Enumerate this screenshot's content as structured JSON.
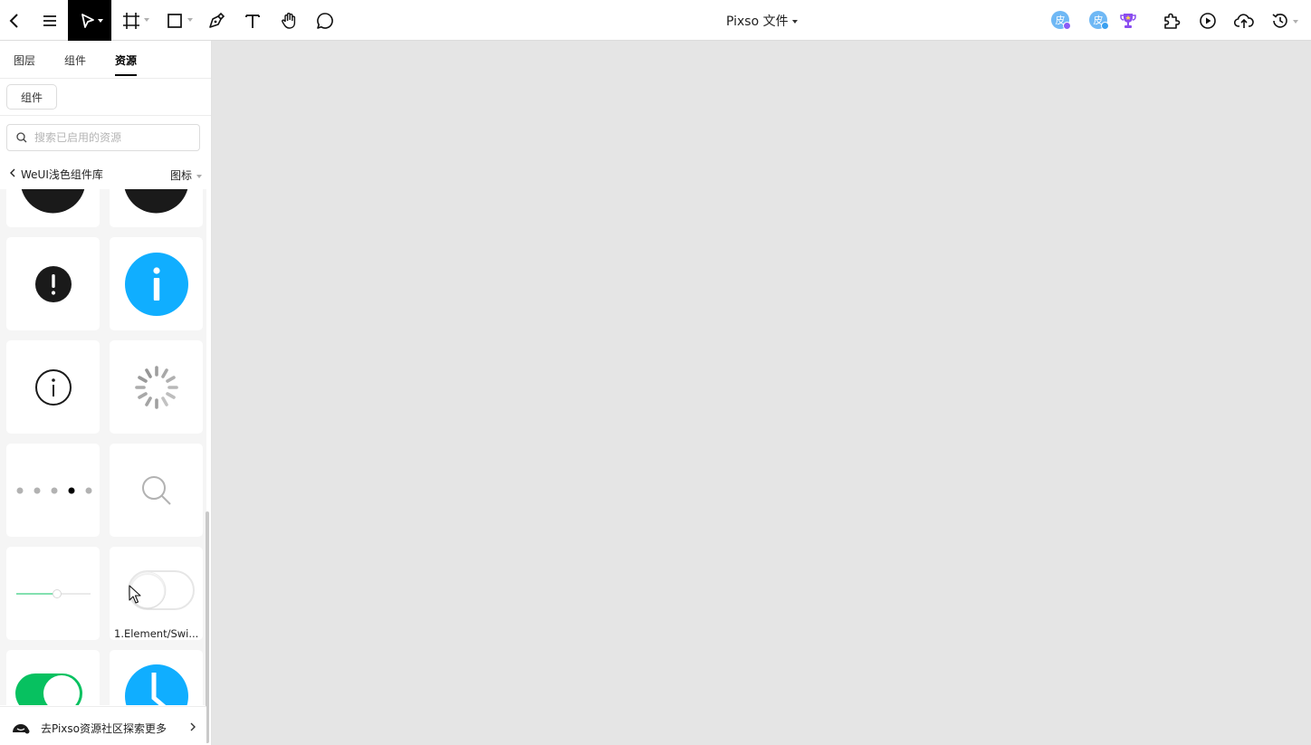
{
  "toolbar": {
    "doc_title": "Pixso 文件",
    "tools": [
      "back-icon",
      "menu-icon",
      "move-tool-icon",
      "frame-tool-icon",
      "shape-tool-icon",
      "pen-tool-icon",
      "text-tool-icon",
      "hand-tool-icon",
      "comment-tool-icon"
    ],
    "right_icons": [
      "plugin-icon",
      "play-icon",
      "upload-icon",
      "history-icon"
    ],
    "avatars": [
      {
        "text": "皮",
        "dot_color": "#8a5cf6"
      },
      {
        "text": "皮",
        "dot_color": "#3aa0f0"
      }
    ],
    "trophy_color": "#8a4df0"
  },
  "sidebar": {
    "tabs": [
      {
        "label": "图层",
        "active": false
      },
      {
        "label": "组件",
        "active": false
      },
      {
        "label": "资源",
        "active": true
      }
    ],
    "chip_label": "组件",
    "search_placeholder": "搜索已启用的资源",
    "library_name": "WeUI浅色组件库",
    "filter_label": "图标",
    "cards": [
      {
        "icon": "play-circle-black-icon"
      },
      {
        "icon": "play-circle-black-icon"
      },
      {
        "icon": "warning-circle-black-icon"
      },
      {
        "icon": "info-circle-blue-icon"
      },
      {
        "icon": "info-outline-icon"
      },
      {
        "icon": "loading-spinner-icon"
      },
      {
        "icon": "pagination-dots-icon",
        "active_dot": 4,
        "dot_count": 5
      },
      {
        "icon": "search-outline-icon"
      },
      {
        "icon": "slider-icon",
        "value": 0.55
      },
      {
        "icon": "switch-off-icon",
        "label": "1.Element/Swi..."
      },
      {
        "icon": "switch-on-icon"
      },
      {
        "icon": "clock-blue-icon"
      }
    ],
    "footer_text": "去Pixso资源社区探索更多"
  },
  "colors": {
    "accent_black": "#000000",
    "info_blue": "#10aeff",
    "switch_green": "#07c160",
    "canvas_bg": "#e5e5e5"
  }
}
